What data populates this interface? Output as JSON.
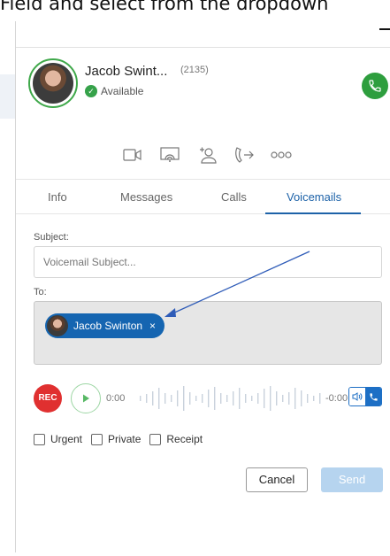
{
  "caption": {
    "text": "Field and select from the dropdown"
  },
  "contact": {
    "name": "Jacob Swint...",
    "extension": "(2135)",
    "status": "Available"
  },
  "actions": [
    "video-icon",
    "screen-share-icon",
    "add-user-icon",
    "transfer-icon",
    "more-icon"
  ],
  "tabs": [
    {
      "label": "Info",
      "active": false
    },
    {
      "label": "Messages",
      "active": false
    },
    {
      "label": "Calls",
      "active": false
    },
    {
      "label": "Voicemails",
      "active": true
    }
  ],
  "form": {
    "subject_label": "Subject:",
    "subject_placeholder": "Voicemail Subject...",
    "to_label": "To:",
    "recipient": "Jacob Swinton",
    "recipient_remove": "×"
  },
  "recorder": {
    "rec_label": "REC",
    "time_start": "0:00",
    "time_end": "-0:00"
  },
  "options": {
    "urgent": "Urgent",
    "private": "Private",
    "receipt": "Receipt"
  },
  "buttons": {
    "cancel": "Cancel",
    "send": "Send"
  },
  "colors": {
    "accent": "#1d62a8",
    "call_green": "#2e9e3e",
    "rec_red": "#e03030",
    "chip_blue": "#1565b1",
    "send_disabled": "#b6d4ef"
  }
}
